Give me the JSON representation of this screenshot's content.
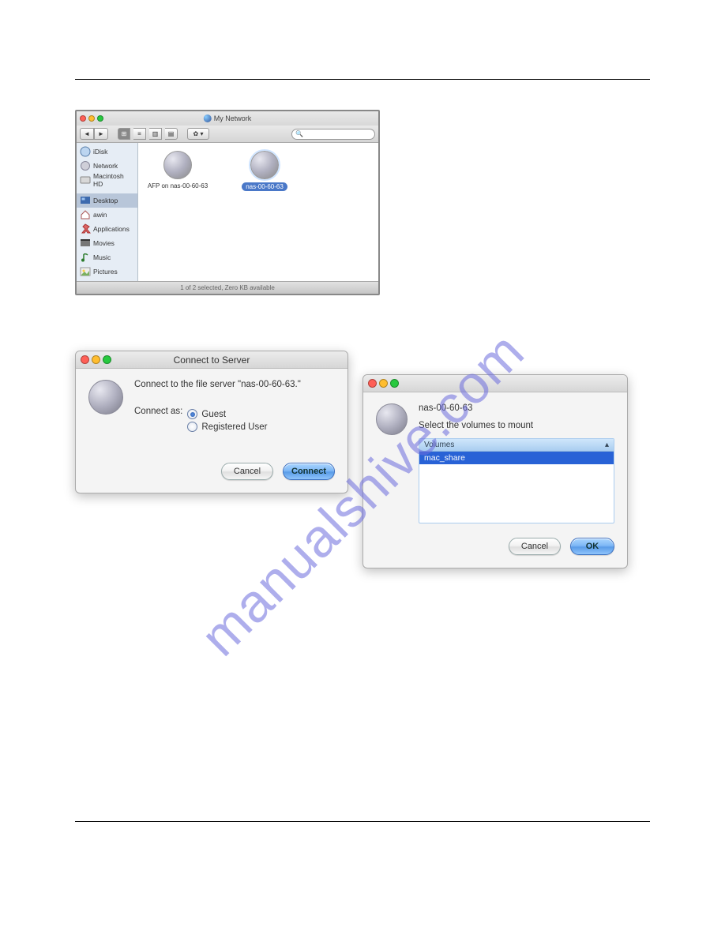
{
  "watermark": "manualshive.com",
  "finder": {
    "title": "My Network",
    "sidebar": [
      {
        "label": "iDisk"
      },
      {
        "label": "Network"
      },
      {
        "label": "Macintosh HD"
      },
      {
        "label": "Desktop"
      },
      {
        "label": "awin"
      },
      {
        "label": "Applications"
      },
      {
        "label": "Movies"
      },
      {
        "label": "Music"
      },
      {
        "label": "Pictures"
      }
    ],
    "items": [
      {
        "label": "AFP on nas-00-60-63"
      },
      {
        "label": "nas-00-60-63"
      }
    ],
    "status": "1 of 2 selected, Zero KB available"
  },
  "connect_dialog": {
    "title": "Connect to Server",
    "message": "Connect to the file server \"nas-00-60-63.\"",
    "connect_as_label": "Connect as:",
    "guest_label": "Guest",
    "registered_label": "Registered User",
    "cancel": "Cancel",
    "connect": "Connect"
  },
  "volumes_dialog": {
    "server_name": "nas-00-60-63",
    "instruction": "Select the volumes to mount",
    "header": "Volumes",
    "rows": [
      "mac_share"
    ],
    "cancel": "Cancel",
    "ok": "OK"
  }
}
